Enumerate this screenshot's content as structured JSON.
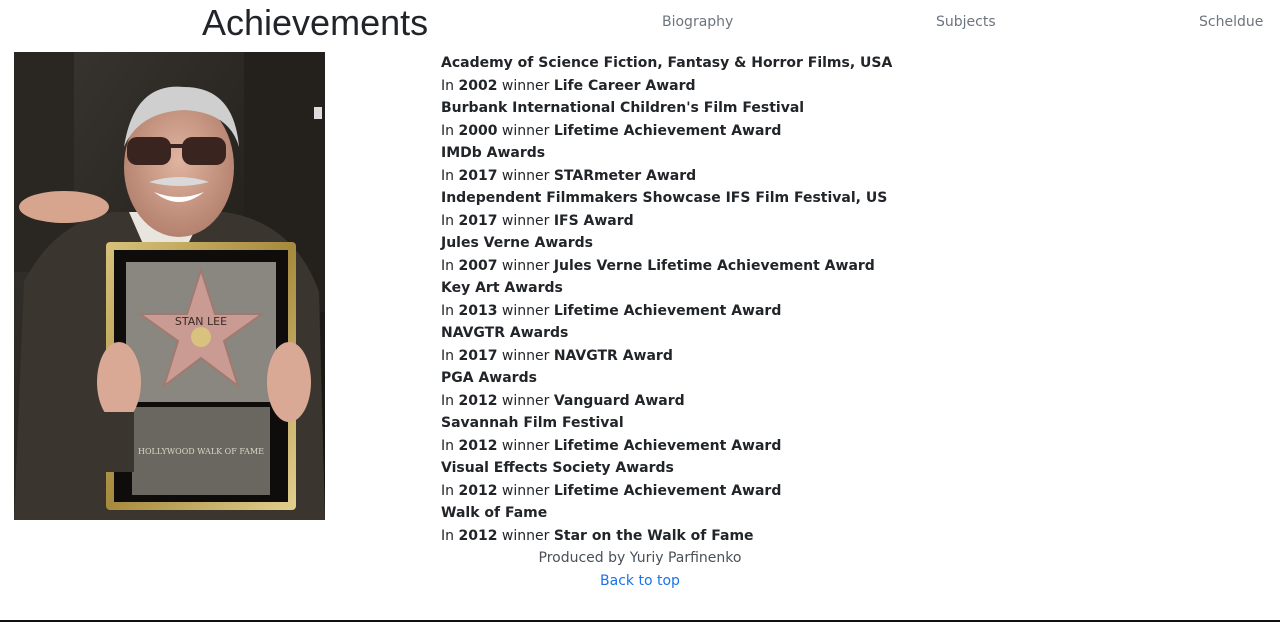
{
  "header": {
    "title": "Achievements",
    "nav": {
      "biography": "Biography",
      "subjects": "Subjects",
      "schedule": "Scheldue"
    }
  },
  "photo": {
    "plaque_name": "STAN LEE",
    "plaque_text": "HOLLYWOOD WALK OF FAME"
  },
  "labels": {
    "in": "In",
    "winner": "winner"
  },
  "awards": [
    {
      "org": "Academy of Science Fiction, Fantasy & Horror Films, USA",
      "year": "2002",
      "award": "Life Career Award"
    },
    {
      "org": "Burbank International Children's Film Festival",
      "year": "2000",
      "award": "Lifetime Achievement Award"
    },
    {
      "org": "IMDb Awards",
      "year": "2017",
      "award": "STARmeter Award"
    },
    {
      "org": "Independent Filmmakers Showcase IFS Film Festival, US",
      "year": "2017",
      "award": "IFS Award"
    },
    {
      "org": "Jules Verne Awards",
      "year": "2007",
      "award": "Jules Verne Lifetime Achievement Award"
    },
    {
      "org": "Key Art Awards",
      "year": "2013",
      "award": "Lifetime Achievement Award"
    },
    {
      "org": "NAVGTR Awards",
      "year": "2017",
      "award": "NAVGTR Award"
    },
    {
      "org": "PGA Awards",
      "year": "2012",
      "award": "Vanguard Award"
    },
    {
      "org": "Savannah Film Festival",
      "year": "2012",
      "award": "Lifetime Achievement Award"
    },
    {
      "org": "Visual Effects Society Awards",
      "year": "2012",
      "award": "Lifetime Achievement Award"
    },
    {
      "org": "Walk of Fame",
      "year": "2012",
      "award": "Star on the Walk of Fame"
    }
  ],
  "footer": {
    "credit": "Produced by Yuriy Parfinenko",
    "back_to_top": "Back to top"
  }
}
